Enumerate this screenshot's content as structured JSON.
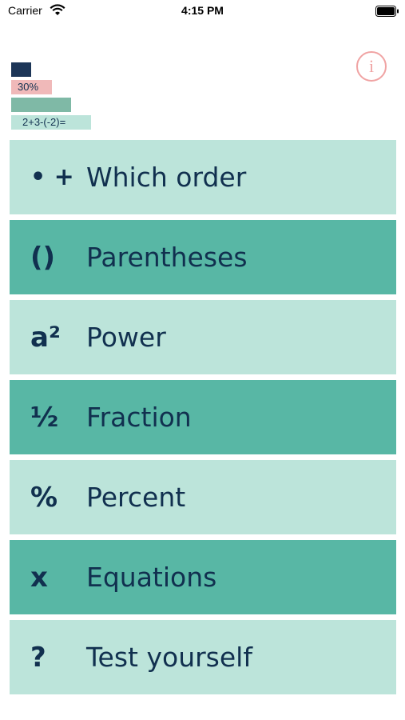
{
  "status_bar": {
    "carrier": "Carrier",
    "time": "4:15 PM"
  },
  "header": {
    "info_glyph": "i",
    "progress_percent": "30%",
    "example_expression": "2+3-(-2)="
  },
  "colors": {
    "navy": "#1c3557",
    "pink": "#f0b9b9",
    "teal_dark": "#58b7a5",
    "teal_light": "#bce4da",
    "text": "#11304f",
    "info": "#f0a3a3"
  },
  "menu": [
    {
      "icon": "• +",
      "label": "Which order"
    },
    {
      "icon": "()",
      "label": "Parentheses"
    },
    {
      "icon": "a²",
      "label": "Power"
    },
    {
      "icon": "½",
      "label": "Fraction"
    },
    {
      "icon": "%",
      "label": "Percent"
    },
    {
      "icon": "x",
      "label": "Equations"
    },
    {
      "icon": "?",
      "label": "Test yourself"
    }
  ]
}
